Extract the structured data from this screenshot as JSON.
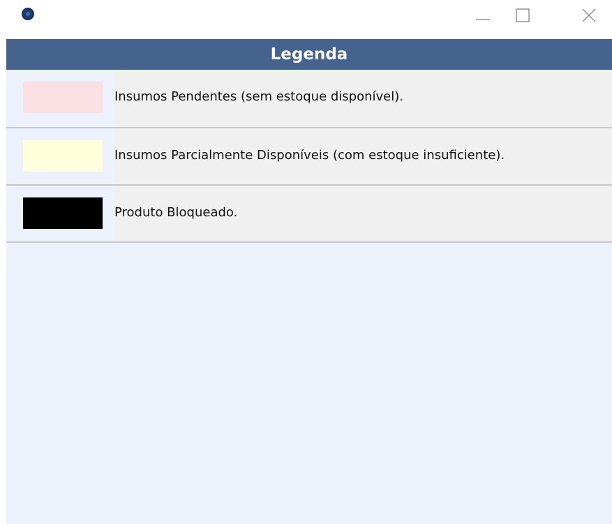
{
  "window": {
    "title": "",
    "controls": {
      "minimize_icon": "minimize-icon",
      "maximize_icon": "maximize-icon",
      "close_icon": "close-icon"
    }
  },
  "legend": {
    "title": "Legenda",
    "header_color": "#46628e",
    "items": [
      {
        "label": "Insumos Pendentes (sem estoque disponível).",
        "color": "#fadfe3"
      },
      {
        "label": "Insumos Parcialmente Disponíveis (com estoque insuficiente).",
        "color": "#ffffdc"
      },
      {
        "label": "Produto Bloqueado.",
        "color": "#000000"
      }
    ]
  }
}
